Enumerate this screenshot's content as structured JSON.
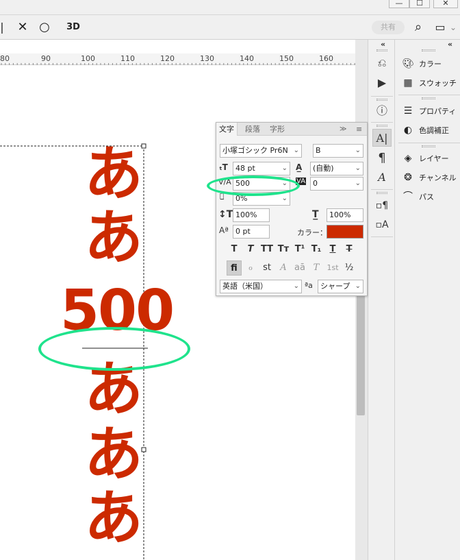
{
  "window": {
    "minimize_label": "—",
    "maximize_label": "☐",
    "close_label": "✕"
  },
  "options_bar": {
    "left_glyph": "|",
    "cancel_icon": "✕",
    "commit_icon": "○",
    "threed_label": "3D",
    "share_label": "共有",
    "search_icon": "⌕",
    "workspace_icon": "▭",
    "workspace_caret": "⌄"
  },
  "ruler": {
    "ticks": [
      "80",
      "90",
      "100",
      "110",
      "120",
      "130",
      "140",
      "150",
      "160"
    ]
  },
  "document": {
    "vertical_text": [
      "あ",
      "あ",
      "500",
      "あ",
      "あ",
      "あ"
    ],
    "text_color": "#cc2a00"
  },
  "character_panel": {
    "tabs": [
      "文字",
      "段落",
      "字形"
    ],
    "expand_icon": "≫",
    "menu_icon": "≡",
    "font_family": "小塚ゴシック Pr6N",
    "font_style": "B",
    "font_size": "48 pt",
    "leading": "(自動)",
    "kerning": "500",
    "tracking": "0",
    "tsume": "0%",
    "vertical_scale": "100%",
    "horizontal_scale": "100%",
    "baseline_shift": "0 pt",
    "color_label": "カラー：",
    "color_value": "#cc2a00",
    "style_buttons": [
      "T",
      "T",
      "TT",
      "Tт",
      "T¹",
      "T₁",
      "T",
      "T"
    ],
    "opentype_buttons": [
      "fi",
      "ℴ",
      "st",
      "A",
      "aā",
      "T",
      "1st",
      "½"
    ],
    "language": "英語（米国）",
    "aa_icon": "ªa",
    "antialias": "シャープ"
  },
  "tools_strip": {
    "collapse_icon": "«",
    "tools": [
      "history-icon",
      "play-icon",
      "info-icon",
      "character-icon",
      "paragraph-icon",
      "glyph-icon",
      "para-style-icon",
      "char-style-icon"
    ]
  },
  "panels": {
    "collapse_icon": "«",
    "items": [
      {
        "label": "カラー",
        "icon": "palette-icon"
      },
      {
        "label": "スウォッチ",
        "icon": "swatches-icon"
      },
      {
        "label": "プロパティ",
        "icon": "properties-icon"
      },
      {
        "label": "色調補正",
        "icon": "adjustments-icon"
      },
      {
        "label": "レイヤー",
        "icon": "layers-icon"
      },
      {
        "label": "チャンネル",
        "icon": "channels-icon"
      },
      {
        "label": "パス",
        "icon": "paths-icon"
      }
    ]
  },
  "highlight_color": "#1fe38c"
}
